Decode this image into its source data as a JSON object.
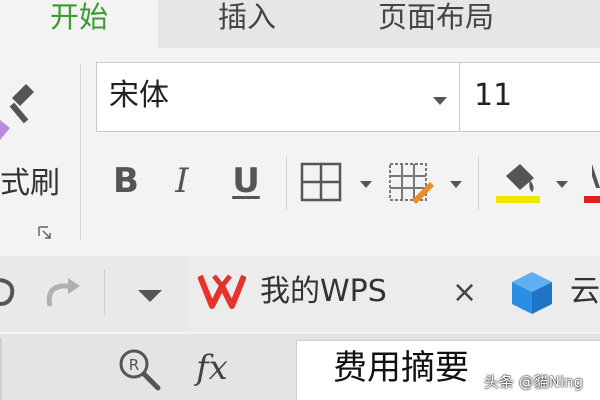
{
  "tabs": [
    {
      "label": "开始",
      "active": true
    },
    {
      "label": "插入",
      "active": false
    },
    {
      "label": "页面布局",
      "active": false
    }
  ],
  "ribbon": {
    "format_painter_label": "式刷",
    "font_name": "宋体",
    "font_size": "11",
    "bold_label": "B",
    "italic_label": "I",
    "underline_label": "U",
    "fill_color": "#f2e600",
    "font_color": "#e02020"
  },
  "doc_tabs": {
    "wps_tab_label": "我的WPS",
    "close_label": "×",
    "cloud_tab_label": "云"
  },
  "formula_bar": {
    "fx_label": "fx",
    "value": "费用摘要"
  },
  "watermark": "头条 @貓Ning",
  "colors": {
    "accent_green": "#3d9a36",
    "wps_red": "#e5322d",
    "cloud_blue": "#2a8de6"
  }
}
